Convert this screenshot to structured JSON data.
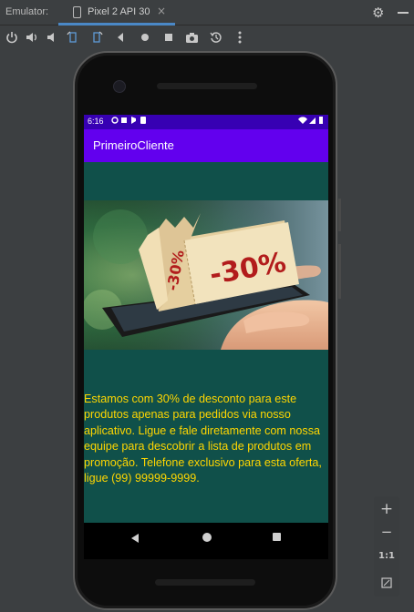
{
  "window": {
    "panel_label": "Emulator:",
    "tab_label": "Pixel 2 API 30",
    "tab_close": "×"
  },
  "toolbar_icons": [
    "power-icon",
    "volume-up-icon",
    "volume-down-icon",
    "rotate-left-icon",
    "rotate-right-icon",
    "back-icon",
    "home-icon",
    "overview-icon",
    "screenshot-icon",
    "snapshot-icon",
    "more-icon"
  ],
  "zoom_controls": {
    "zoom_in": "+",
    "zoom_out": "−",
    "actual_size": "1:1"
  },
  "device": {
    "status_bar": {
      "time": "6:16"
    },
    "app_bar": {
      "title": "PrimeiroCliente"
    },
    "promo_image": {
      "tag_small": "-30%",
      "tag_large": "-30%"
    },
    "body_text": "Estamos com 30% de desconto para este produtos apenas para pedidos via nosso aplicativo. Ligue e fale diretamente com nossa equipe para descobrir a lista de produtos em promoção. Telefone exclusivo para esta oferta, ligue (99) 99999-9999.",
    "colors": {
      "status_bar": "#3700b3",
      "app_bar": "#6200ee",
      "background": "#10504a",
      "text": "#ffd600"
    }
  }
}
